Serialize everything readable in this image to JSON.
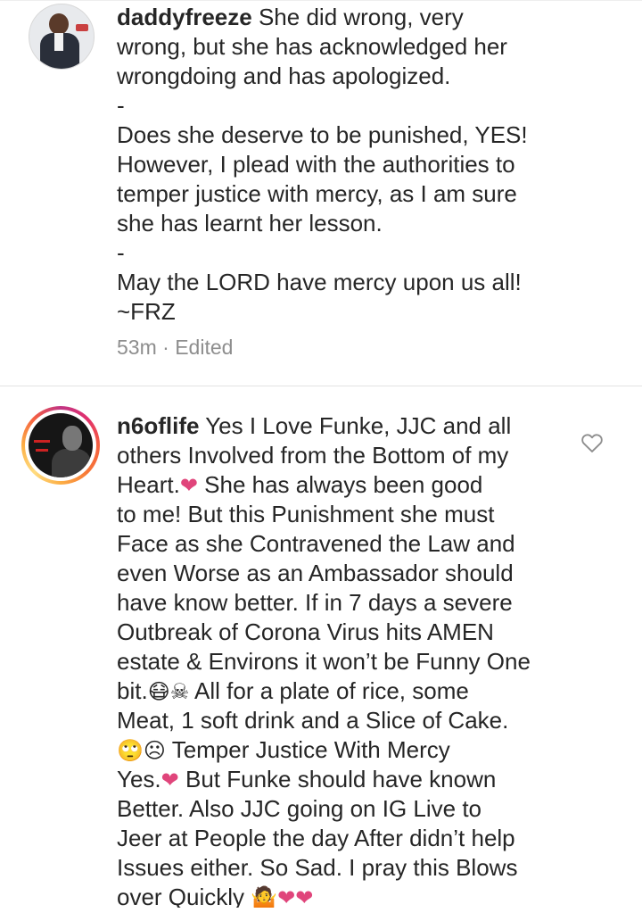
{
  "comments": [
    {
      "username": "daddyfreeze",
      "lines": [
        "She did wrong, very",
        "wrong, but she has acknowledged her",
        "wrongdoing and has apologized.",
        "-",
        "Does she deserve to be punished, YES!",
        "However, I plead with the authorities to",
        "temper justice with mercy, as I am sure",
        "she has learnt her lesson.",
        "-",
        "May the LORD have mercy upon us all!",
        "~FRZ"
      ],
      "time": "53m",
      "separator": "·",
      "edited": "Edited",
      "avatar_icon": "profile-photo"
    },
    {
      "username": "n6oflife",
      "lines": [
        "Yes I Love Funke, JJC and all",
        "others Involved from the Bottom of my",
        "Heart.",
        "She has always been good",
        "to me! But this Punishment she must",
        "Face as she Contravened the Law and",
        "even Worse as an Ambassador should",
        "have know better. If in 7 days a severe",
        "Outbreak of Corona Virus hits AMEN",
        "estate & Environs it won’t be Funny One",
        "bit.",
        "All for a plate of rice, some",
        "Meat, 1 soft drink and a Slice of Cake.",
        "Temper Justice With Mercy",
        "Yes.",
        "But Funke should have known",
        "Better. Also JJC going on IG Live to",
        "Jeer at People the day After didn’t help",
        "Issues either. So Sad. I pray this Blows",
        "over Quickly"
      ],
      "emoji": {
        "heart": "❤",
        "mask": "😷",
        "skull": "☠",
        "eyeroll": "🙄",
        "frown": "☹",
        "shrug": "🤷"
      },
      "avatar_icon": "profile-photo-story-ring",
      "like_icon": "heart-outline-icon"
    }
  ]
}
